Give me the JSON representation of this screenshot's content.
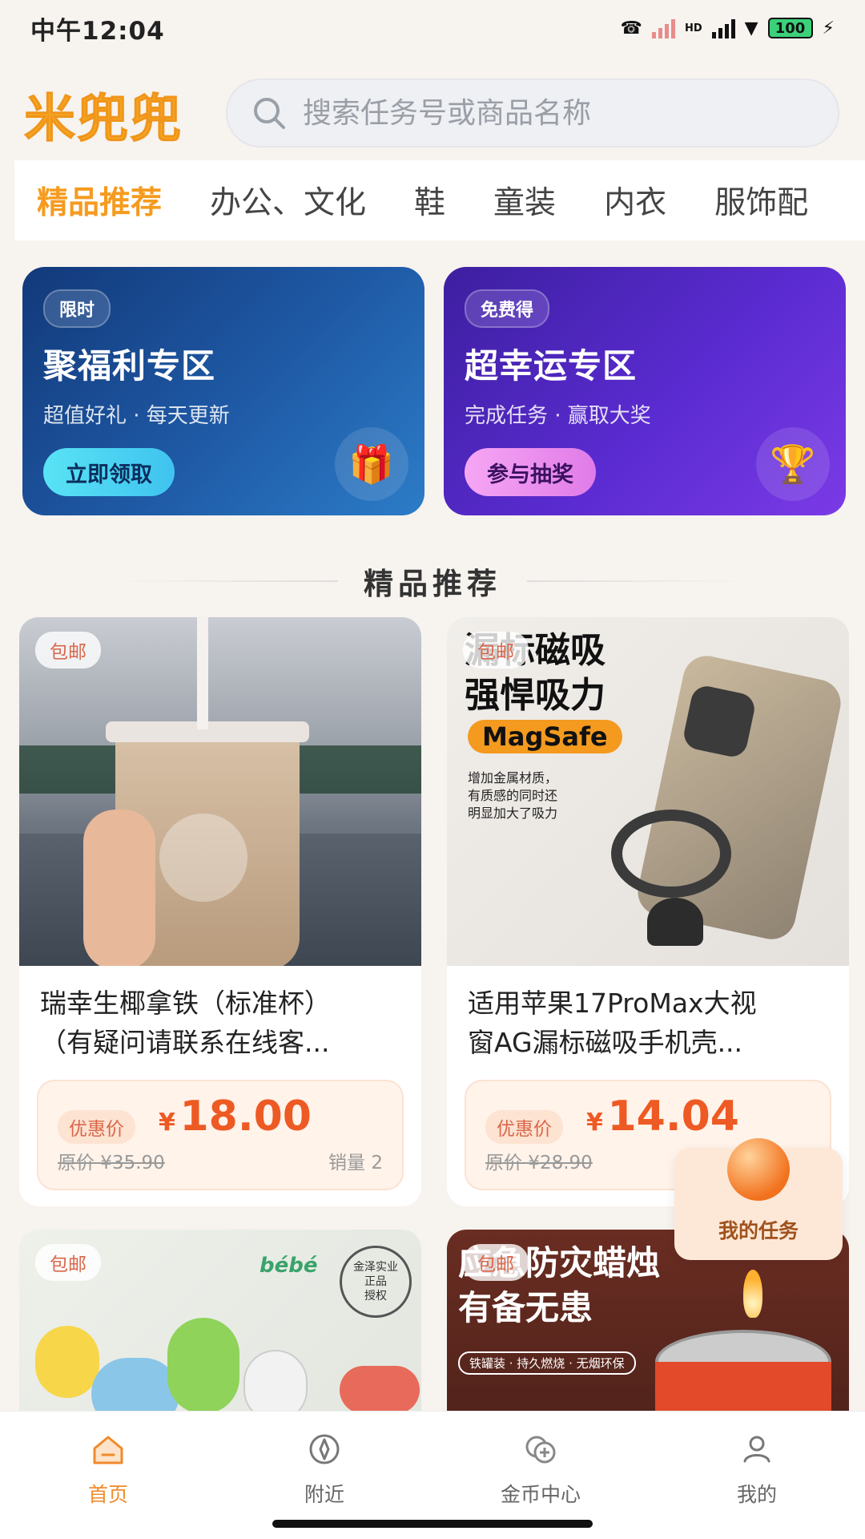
{
  "status_bar": {
    "time": "中午12:04",
    "network": "HD",
    "battery": "100"
  },
  "app": {
    "logo": "米兜兜"
  },
  "search": {
    "placeholder": "搜索任务号或商品名称"
  },
  "tabs": [
    {
      "label": "精品推荐",
      "active": true
    },
    {
      "label": "办公、文化",
      "active": false
    },
    {
      "label": "鞋",
      "active": false
    },
    {
      "label": "童装",
      "active": false
    },
    {
      "label": "内衣",
      "active": false
    },
    {
      "label": "服饰配",
      "active": false
    }
  ],
  "promos": [
    {
      "badge": "限时",
      "title": "聚福利专区",
      "subtitle": "超值好礼 · 每天更新",
      "button": "立即领取",
      "icon": "gift-icon"
    },
    {
      "badge": "免费得",
      "title": "超幸运专区",
      "subtitle": "完成任务 · 赢取大奖",
      "button": "参与抽奖",
      "icon": "trophy-icon"
    }
  ],
  "section": {
    "title": "精品推荐"
  },
  "products": [
    {
      "ship": "包邮",
      "name_line1": "瑞幸生椰拿铁（标准杯）",
      "name_line2": "（有疑问请联系在线客...",
      "price_tag": "优惠价",
      "currency": "¥",
      "price": "18.00",
      "original": "原价 ¥35.90",
      "sold": "销量 2",
      "image_text": []
    },
    {
      "ship": "包邮",
      "name_line1": "适用苹果17ProMax大视",
      "name_line2": "窗AG漏标磁吸手机壳...",
      "price_tag": "优惠价",
      "currency": "¥",
      "price": "14.04",
      "original": "原价 ¥28.90",
      "sold": "",
      "image_text": [
        "漏标磁吸",
        "强悍吸力",
        "MagSafe",
        "增加金属材质，",
        "有质感的同时还",
        "明显加大了吸力"
      ]
    },
    {
      "ship": "包邮",
      "image_text": [
        "bébé",
        "金泽实业",
        "正品",
        "授权"
      ]
    },
    {
      "ship": "包邮",
      "image_text": [
        "应急防灾蜡烛",
        "有备无患",
        "铁罐装 · 持久燃烧 · 无烟环保"
      ]
    }
  ],
  "float_task": {
    "label": "我的任务"
  },
  "bottom_nav": [
    {
      "label": "首页",
      "icon": "home-icon",
      "active": true
    },
    {
      "label": "附近",
      "icon": "compass-icon",
      "active": false
    },
    {
      "label": "金币中心",
      "icon": "coins-icon",
      "active": false
    },
    {
      "label": "我的",
      "icon": "user-icon",
      "active": false
    }
  ],
  "colors": {
    "accent": "#f59b1f",
    "price": "#ee5a24",
    "promo_blue": "#1f5aa6",
    "promo_purple": "#5a2bd0"
  }
}
